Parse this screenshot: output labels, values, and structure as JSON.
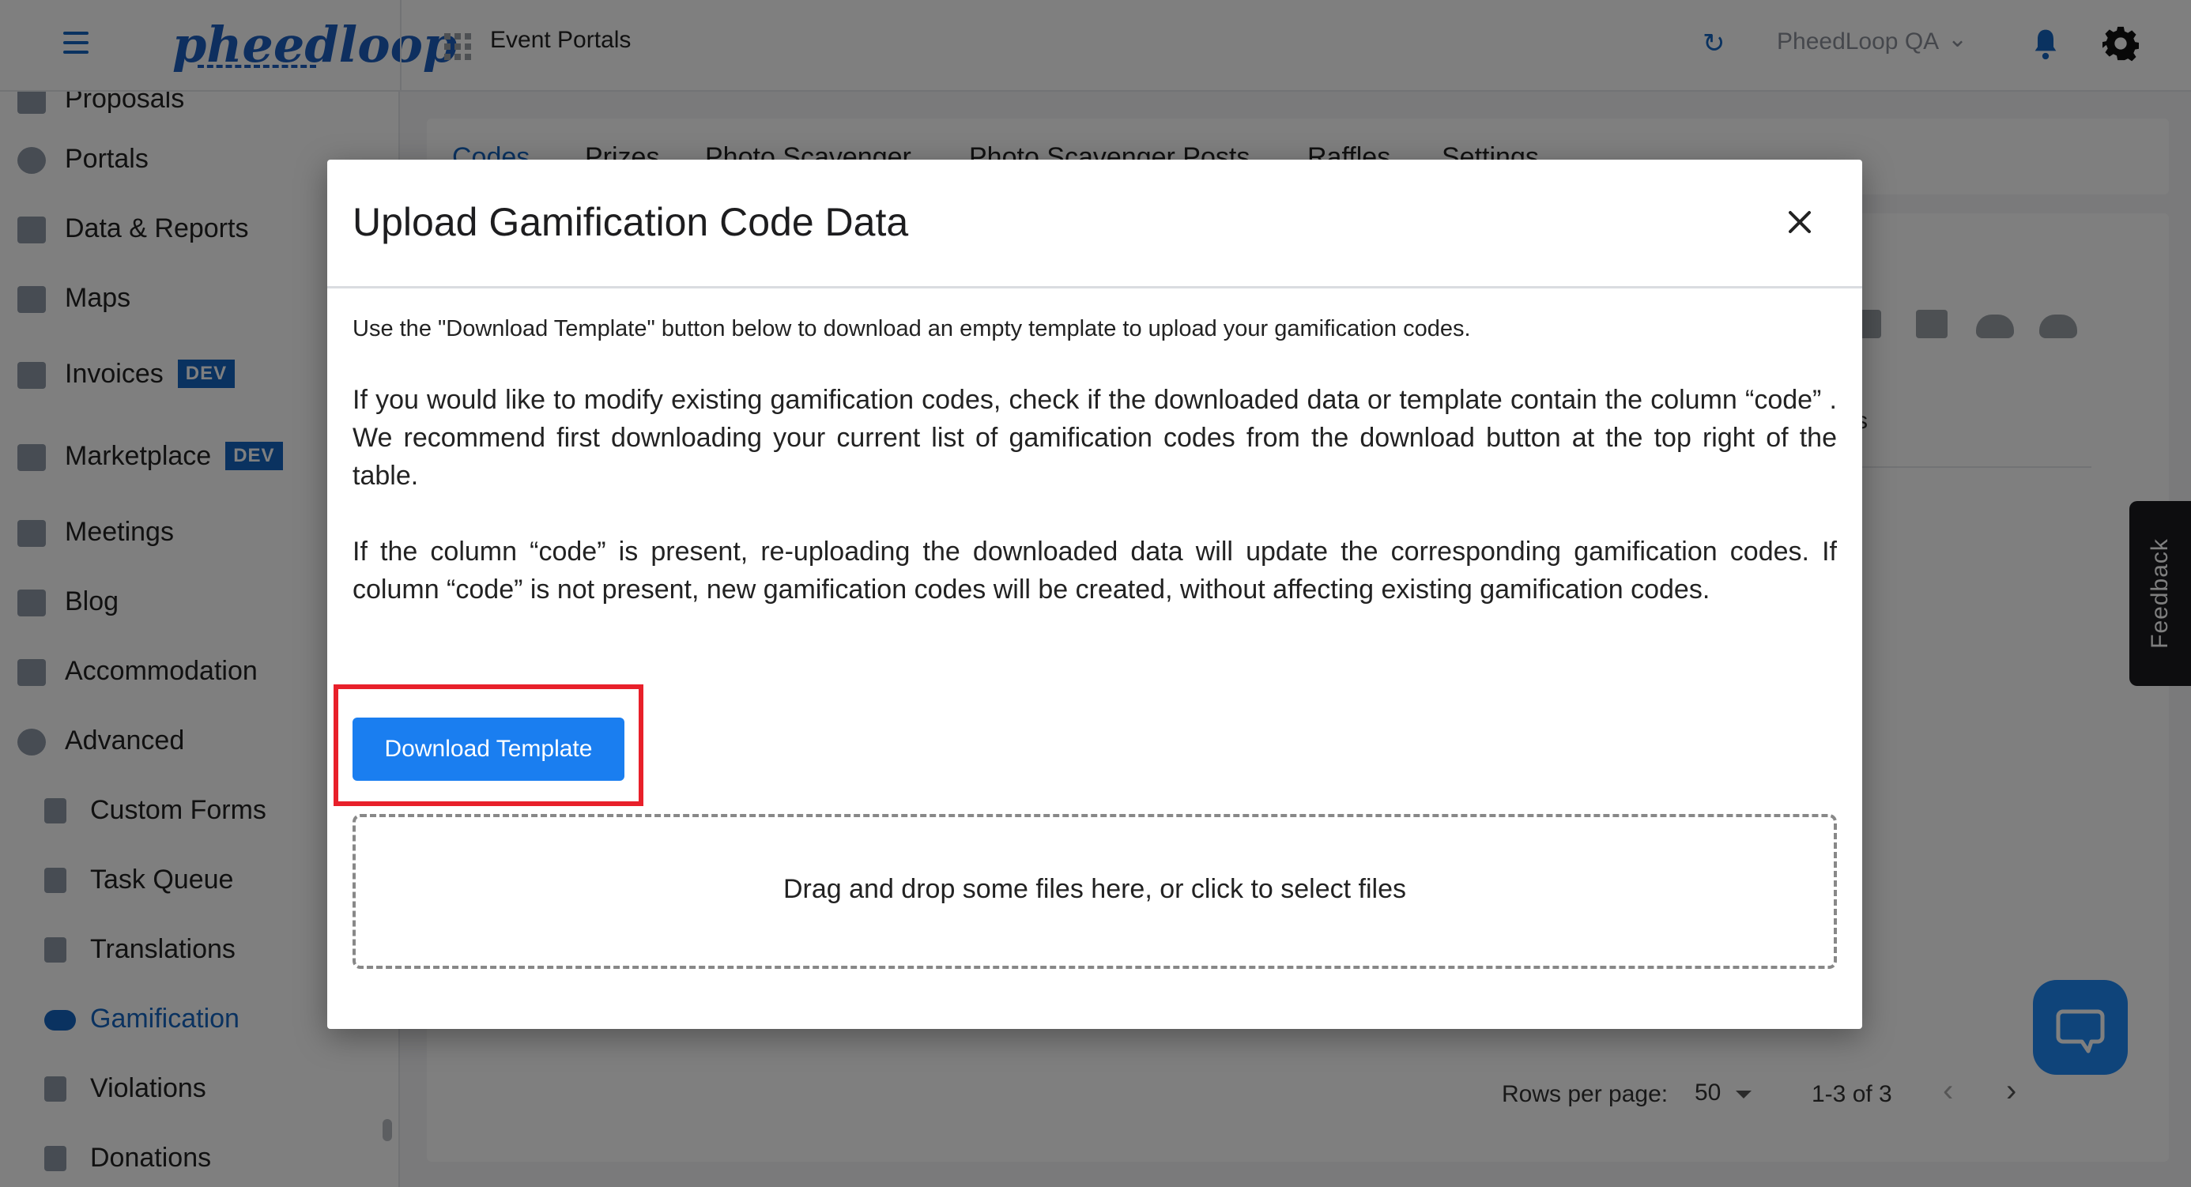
{
  "header": {
    "logo_text": "pheedloop",
    "portal_title": "Event Portals",
    "org_name": "PheedLoop QA",
    "icons": [
      "hamburger-icon",
      "grid-icon",
      "refresh-icon",
      "chevron-down-icon",
      "bell-icon",
      "gear-icon"
    ],
    "accent_color": "#1565c0"
  },
  "sidebar": {
    "items": [
      {
        "label": "Proposals"
      },
      {
        "label": "Portals"
      },
      {
        "label": "Data & Reports"
      },
      {
        "label": "Maps"
      },
      {
        "label": "Invoices",
        "badge": "DEV"
      },
      {
        "label": "Marketplace",
        "badge": "DEV"
      },
      {
        "label": "Meetings"
      },
      {
        "label": "Blog"
      },
      {
        "label": "Accommodation"
      },
      {
        "label": "Advanced"
      },
      {
        "label": "Custom Forms"
      },
      {
        "label": "Task Queue"
      },
      {
        "label": "Translations"
      },
      {
        "label": "Gamification",
        "active": true
      },
      {
        "label": "Violations"
      },
      {
        "label": "Donations"
      }
    ]
  },
  "content": {
    "tabs": [
      "Codes",
      "Prizes",
      "Photo Scavenger",
      "Photo Scavenger Posts",
      "Raffles",
      "Settings"
    ],
    "active_tab": "Codes",
    "partial_header": "s",
    "pagination": {
      "rows_per_page_label": "Rows per page:",
      "rows_per_page_value": "50",
      "range": "1-3 of 3"
    }
  },
  "feedback": {
    "label": "Feedback"
  },
  "modal": {
    "title": "Upload Gamification Code Data",
    "intro": "Use the \"Download Template\" button below to download an empty template to upload your gamification codes.",
    "para1": "If you would like to modify existing gamification codes, check if the downloaded data or template contain the column “code” . We recommend first downloading your current list of gamification codes from the download button at the top right of the table.",
    "para2": "If the column “code” is present, re-uploading the downloaded data will update the corresponding gamification codes. If column “code” is not present, new gamification codes will be created, without affecting existing gamification codes.",
    "download_label": "Download Template",
    "dropzone_text": "Drag and drop some files here, or click to select files",
    "button_color": "#1a7ef0",
    "highlight_color": "#e8202a"
  }
}
